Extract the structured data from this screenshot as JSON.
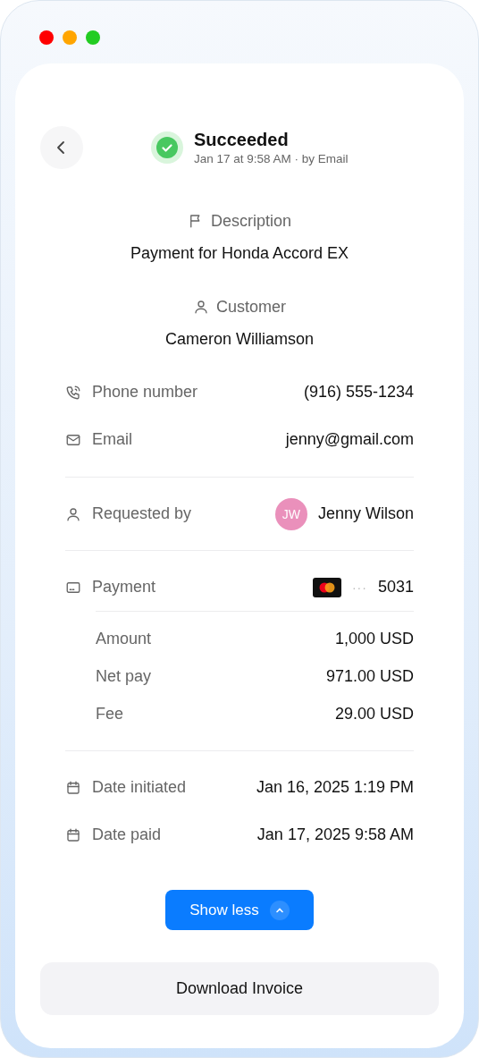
{
  "window_controls": [
    {
      "color": "#ff0000"
    },
    {
      "color": "#ffa500"
    },
    {
      "color": "#22cc22"
    }
  ],
  "header": {
    "status": "Succeeded",
    "meta": "Jan 17 at 9:58 AM · by Email"
  },
  "sections": [
    {
      "kind": "flag",
      "label": "Description",
      "value": "Payment for Honda Accord EX"
    },
    {
      "kind": "person",
      "label": "Customer",
      "value": "Cameron Williamson"
    }
  ],
  "groups": [
    {
      "rows": [
        {
          "kind": "phone",
          "label": "Phone number",
          "value": "(916) 555-1234"
        },
        {
          "kind": "mail",
          "label": "Email",
          "value": "jenny@gmail.com"
        }
      ]
    },
    {
      "rows": [
        {
          "kind": "person",
          "label": "Requested by",
          "value": "Jenny Wilson",
          "initials": "JW",
          "color": "#ea90bb"
        }
      ]
    },
    {
      "rows": [
        {
          "kind": "card",
          "label": "Payment",
          "masked": "···",
          "value": "5031",
          "children": [
            {
              "label": "Amount",
              "value": "1,000 USD"
            },
            {
              "label": "Net pay",
              "value": "971.00 USD"
            },
            {
              "label": "Fee",
              "value": "29.00 USD"
            }
          ]
        }
      ]
    },
    {
      "rows": [
        {
          "kind": "calendar",
          "label": "Date initiated",
          "value": "Jan 16, 2025 1:19 PM"
        },
        {
          "kind": "calendar",
          "label": "Date paid",
          "value": "Jan 17, 2025 9:58 AM"
        }
      ]
    }
  ],
  "toggle_button": {
    "label": "Show less"
  },
  "download_button": {
    "label": "Download Invoice"
  }
}
